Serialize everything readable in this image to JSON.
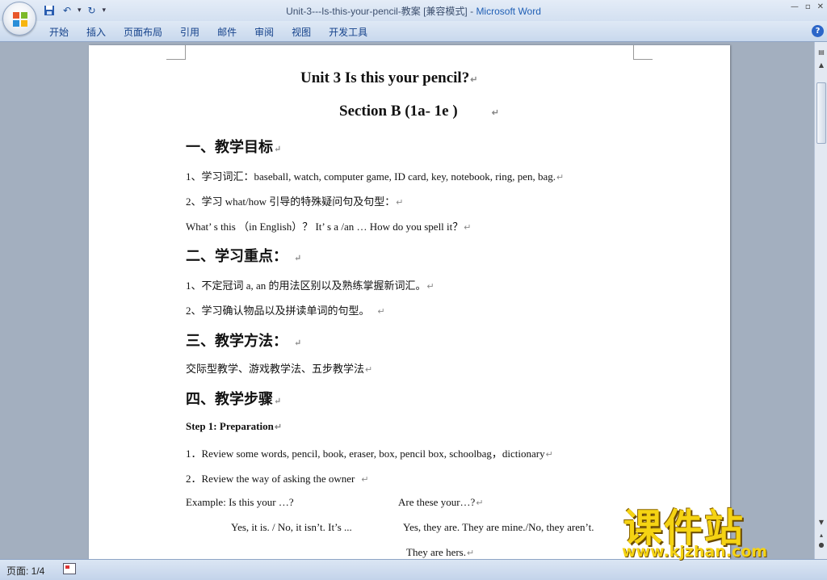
{
  "window": {
    "title_doc": "Unit-3---Is-this-your-pencil-教案 [兼容模式] - ",
    "title_app": "Microsoft Word"
  },
  "ribbon": {
    "tabs": [
      "开始",
      "插入",
      "页面布局",
      "引用",
      "邮件",
      "审阅",
      "视图",
      "开发工具"
    ]
  },
  "status": {
    "page": "页面: 1/4"
  },
  "document": {
    "title": "Unit 3      Is this your pencil?",
    "subtitle": "Section B (1a- 1e )",
    "sec1": "一、教学目标",
    "l1": "1、学习词汇：baseball, watch, computer game, ID card, key, notebook, ring, pen, bag.",
    "l2": " 2、学习 what/how 引导的特殊疑问句及句型：",
    "l3": "What’ s this （in English）？ It’ s a /an …   How do you spell it？",
    "sec2": "二、学习重点：",
    "l4": "1、不定冠词 a, an 的用法区别以及熟练掌握新词汇。",
    "l5": "2、学习确认物品以及拼读单词的句型。",
    "sec3": "三、教学方法：",
    "l6": "交际型教学、游戏教学法、五步教学法",
    "sec4": "四、教学步骤",
    "step1": "Step 1: Preparation",
    "l7": "1．Review some words,  pencil, book, eraser, box, pencil box, schoolbag，dictionary",
    "l8": "2．Review the way of asking the owner",
    "ex_left": " Example: Is this your …?",
    "ex_right": "Are these your…?",
    "ans_left": "Yes,  it  is.  / No, it  isn’t. It’s ...",
    "ans_right": "Yes,  they  are.  They  are  mine./No,  they  aren’t.",
    "ans_right2": "They are hers.",
    "para_mark": "↵"
  },
  "watermark": {
    "text": "课件站",
    "url": "www.kjzhan.com"
  }
}
